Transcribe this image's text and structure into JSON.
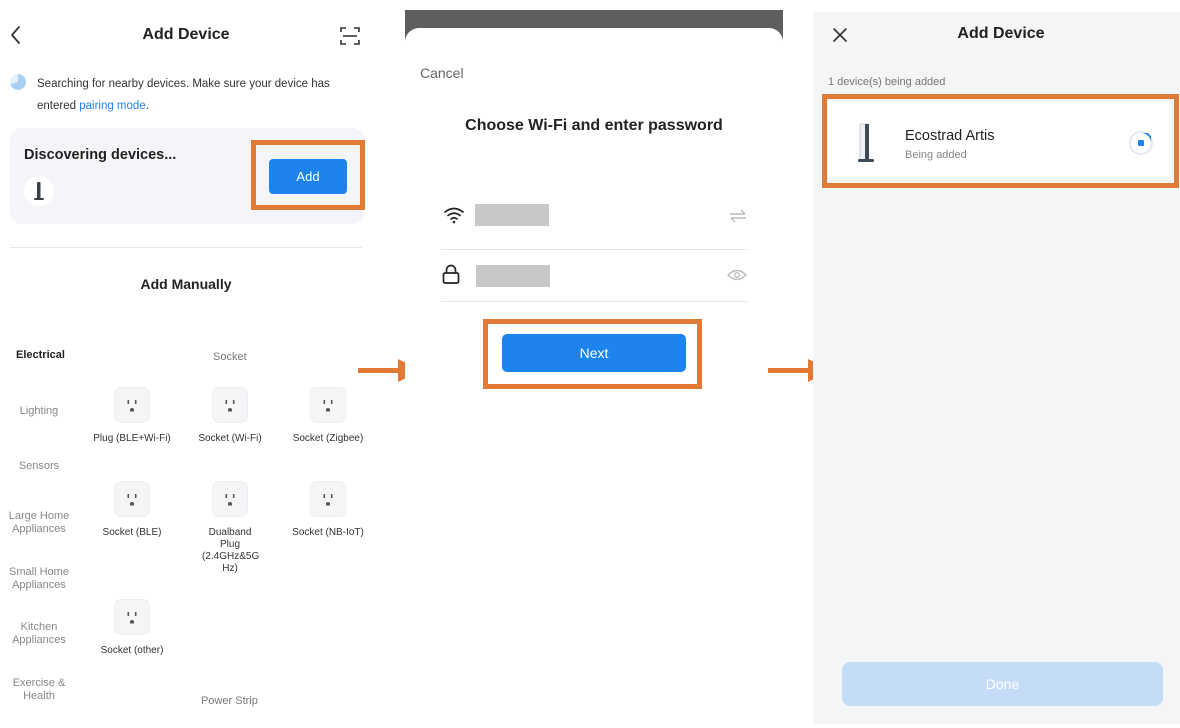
{
  "panel1": {
    "title": "Add Device",
    "search_text": "Searching for nearby devices. Make sure your device has entered",
    "pairing_link": "pairing mode",
    "period": ".",
    "discovering_title": "Discovering devices...",
    "add_label": "Add",
    "add_manually_title": "Add Manually",
    "categories": [
      {
        "label": "Electrical",
        "active": true
      },
      {
        "label": "Lighting"
      },
      {
        "label": "Sensors"
      },
      {
        "label": "Large Home Appliances"
      },
      {
        "label": "Small Home Appliances"
      },
      {
        "label": "Kitchen Appliances"
      },
      {
        "label": "Exercise & Health"
      }
    ],
    "section_socket": "Socket",
    "section_power_strip": "Power Strip",
    "tiles": [
      {
        "label": "Plug (BLE+Wi-Fi)",
        "icon": "socket-icon"
      },
      {
        "label": "Socket (Wi-Fi)",
        "icon": "socket-icon"
      },
      {
        "label": "Socket (Zigbee)",
        "icon": "socket-icon"
      },
      {
        "label": "Socket (BLE)",
        "icon": "socket-icon"
      },
      {
        "label": "Dualband Plug (2.4GHz&5G Hz)",
        "icon": "socket-icon"
      },
      {
        "label": "Socket (NB-IoT)",
        "icon": "socket-icon"
      },
      {
        "label": "Socket (other)",
        "icon": "socket-icon"
      }
    ]
  },
  "panel2": {
    "cancel_label": "Cancel",
    "title": "Choose Wi-Fi and enter password",
    "next_label": "Next"
  },
  "panel3": {
    "title": "Add Device",
    "count_text": "1 device(s) being added",
    "device_name": "Ecostrad Artis",
    "device_status": "Being added",
    "done_label": "Done"
  },
  "colors": {
    "accent": "#1d83ee",
    "highlight": "#e07a36",
    "link": "#1e83e6",
    "done_disabled": "#c5dcf8"
  }
}
